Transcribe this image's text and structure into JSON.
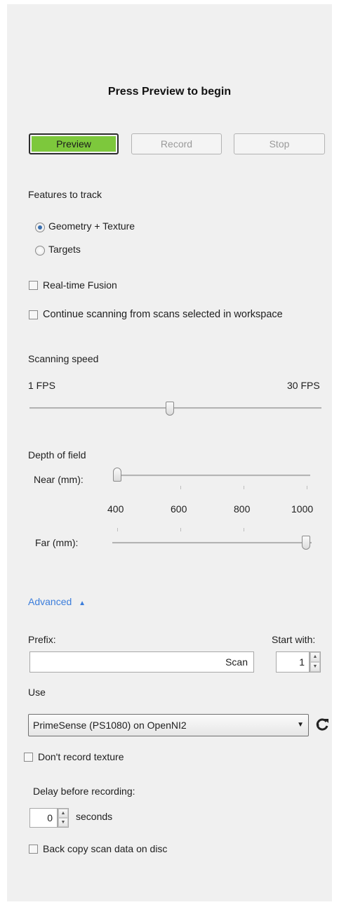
{
  "header": {
    "title": "Press Preview to begin"
  },
  "controls": {
    "preview": "Preview",
    "record": "Record",
    "stop": "Stop"
  },
  "features": {
    "label": "Features to track",
    "options": [
      {
        "label": "Geometry + Texture",
        "selected": true
      },
      {
        "label": "Targets",
        "selected": false
      }
    ]
  },
  "checks": {
    "realtime_fusion": {
      "label": "Real-time Fusion",
      "checked": false
    },
    "continue_scanning": {
      "label": "Continue scanning from scans selected in workspace",
      "checked": false
    }
  },
  "speed": {
    "label": "Scanning speed",
    "min_label": "1 FPS",
    "max_label": "30 FPS",
    "value_fraction": 0.48
  },
  "depth": {
    "label": "Depth of field",
    "near_label": "Near (mm):",
    "far_label": "Far (mm):",
    "ticks": [
      "400",
      "600",
      "800",
      "1000"
    ],
    "near_value": 400,
    "far_value": 1000
  },
  "advanced": {
    "label": "Advanced",
    "expanded": true,
    "arrow": "triangle-up-icon"
  },
  "prefix": {
    "label": "Prefix:",
    "value": "Scan"
  },
  "start_with": {
    "label": "Start with:",
    "value": "1"
  },
  "use": {
    "label": "Use",
    "selected": "PrimeSense (PS1080) on OpenNI2",
    "refresh_icon": "refresh-icon"
  },
  "dont_record_texture": {
    "label": "Don't record texture",
    "checked": false
  },
  "delay": {
    "label": "Delay before recording:",
    "value": "0",
    "unit": "seconds"
  },
  "back_copy": {
    "label": "Back copy scan data on disc",
    "checked": false
  },
  "colors": {
    "accent_green": "#7dc83c",
    "link_blue": "#3b7ddb"
  }
}
